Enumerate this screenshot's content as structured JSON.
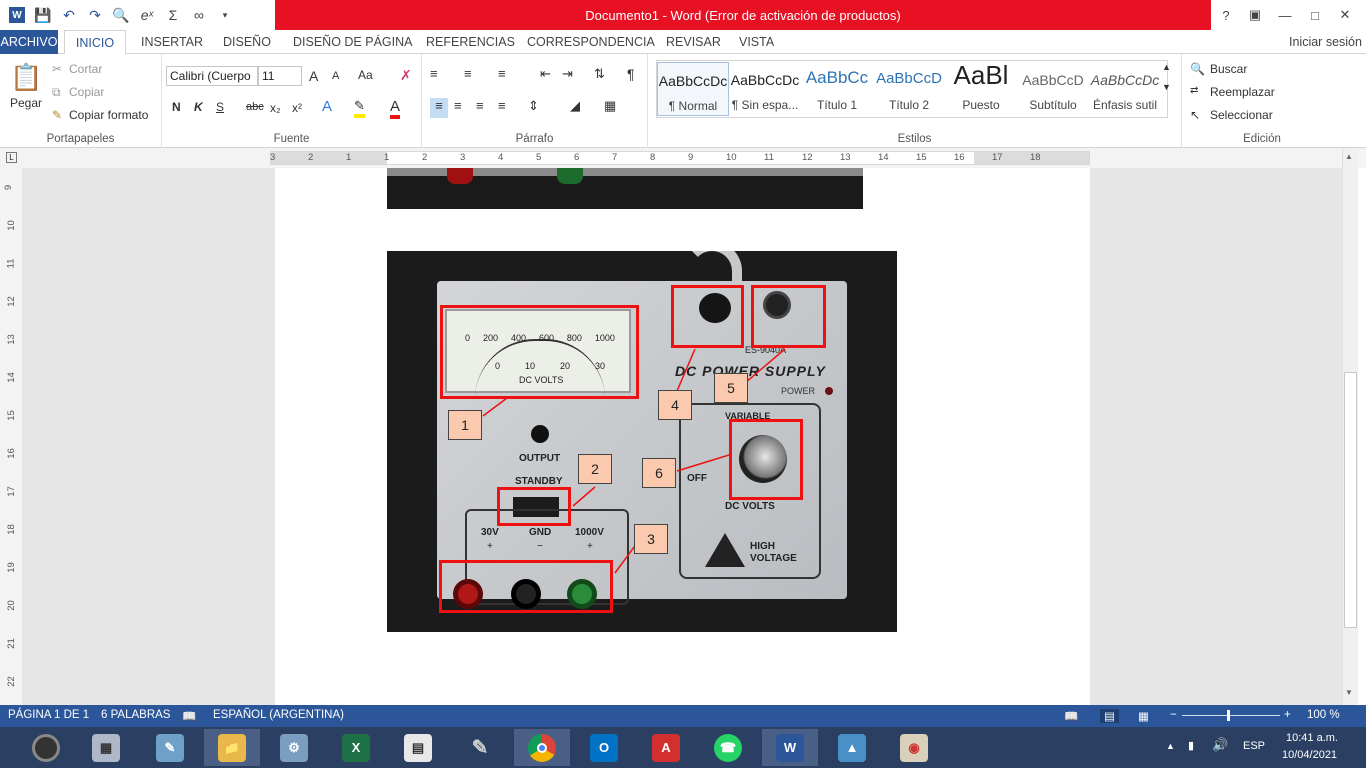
{
  "window": {
    "title": "Documento1 -  Word (Error de activación de productos)",
    "help": "?"
  },
  "tabs": [
    {
      "label": "ARCHIVO"
    },
    {
      "label": "INICIO"
    },
    {
      "label": "INSERTAR"
    },
    {
      "label": "DISEÑO"
    },
    {
      "label": "DISEÑO DE PÁGINA"
    },
    {
      "label": "REFERENCIAS"
    },
    {
      "label": "CORRESPONDENCIA"
    },
    {
      "label": "REVISAR"
    },
    {
      "label": "VISTA"
    }
  ],
  "signin": "Iniciar sesión",
  "clipboard": {
    "paste": "Pegar",
    "cut": "Cortar",
    "copy": "Copiar",
    "format_painter": "Copiar formato",
    "group": "Portapapeles"
  },
  "font": {
    "name": "Calibri (Cuerpo",
    "size": "11",
    "bold": "N",
    "italic": "K",
    "underline": "S",
    "strike": "abc",
    "subscript": "x₂",
    "superscript": "x²",
    "grow": "A",
    "shrink": "A",
    "case": "Aa",
    "effects": "A",
    "color": "A",
    "group": "Fuente"
  },
  "paragraph": {
    "pilcrow": "¶",
    "group": "Párrafo"
  },
  "styles": {
    "items": [
      {
        "sample": "AaBbCcDc",
        "name": "¶ Normal"
      },
      {
        "sample": "AaBbCcDc",
        "name": "¶ Sin espa..."
      },
      {
        "sample": "AaBbCc",
        "name": "Título 1"
      },
      {
        "sample": "AaBbCcD",
        "name": "Título 2"
      },
      {
        "sample": "AaBl",
        "name": "Puesto"
      },
      {
        "sample": "AaBbCcD",
        "name": "Subtítulo"
      },
      {
        "sample": "AaBbCcDc",
        "name": "Énfasis sutil"
      }
    ],
    "group": "Estilos"
  },
  "editing": {
    "find": "Buscar",
    "replace": "Reemplazar",
    "select": "Seleccionar",
    "group": "Edición"
  },
  "ruler_h": [
    "3",
    "2",
    "1",
    "1",
    "2",
    "3",
    "4",
    "5",
    "6",
    "7",
    "8",
    "9",
    "10",
    "11",
    "12",
    "13",
    "14",
    "15",
    "16",
    "17",
    "18"
  ],
  "ruler_v": [
    "9",
    "10",
    "11",
    "12",
    "13",
    "14",
    "15",
    "16",
    "17",
    "18",
    "19",
    "20",
    "21",
    "22"
  ],
  "photo": {
    "meter_top": [
      "0",
      "200",
      "400",
      "600",
      "800",
      "1000"
    ],
    "meter_bottom": [
      "0",
      "10",
      "20",
      "30"
    ],
    "meter_unit": "DC VOLTS",
    "panel_title": "DC POWER SUPPLY",
    "model": "ES-9040A",
    "power": "POWER",
    "variable": "VARIABLE",
    "output": "OUTPUT",
    "standby": "STANDBY",
    "off": "OFF",
    "dc_volts": "DC VOLTS",
    "hv1": "HIGH",
    "hv2": "VOLTAGE",
    "term_30v": "30V",
    "term_gnd": "GND",
    "term_1000v": "1000V",
    "plus": "+",
    "minus": "−",
    "labels": [
      "1",
      "2",
      "3",
      "4",
      "5",
      "6"
    ]
  },
  "status": {
    "page": "PÁGINA 1 DE 1",
    "words": "6 PALABRAS",
    "language": "ESPAÑOL (ARGENTINA)",
    "zoom": "100 %",
    "zoom_minus": "−",
    "zoom_plus": "+"
  },
  "taskbar": {
    "language": "ESP",
    "time": "10:41 a.m.",
    "date": "10/04/2021"
  }
}
